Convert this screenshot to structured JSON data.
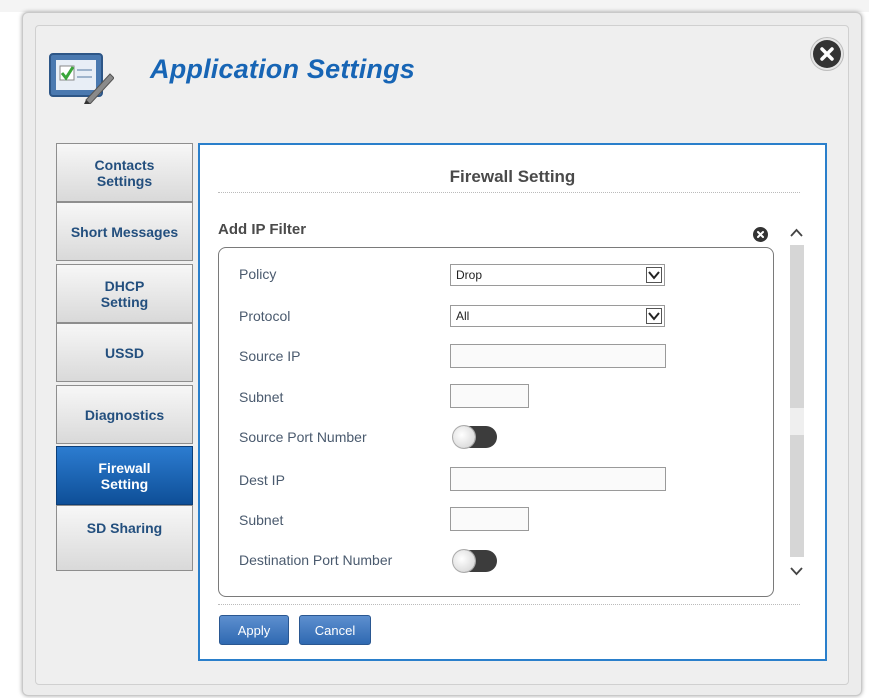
{
  "app": {
    "title": "Application Settings",
    "icon": "checklist-pen-icon"
  },
  "sidebar": {
    "items": [
      {
        "label": "Contacts Settings",
        "active": false
      },
      {
        "label": "Short Messages",
        "active": false
      },
      {
        "label": "DHCP Setting",
        "active": false
      },
      {
        "label": "USSD",
        "active": false
      },
      {
        "label": "Diagnostics",
        "active": false
      },
      {
        "label": "Firewall Setting",
        "active": true
      },
      {
        "label": "SD Sharing",
        "active": false
      }
    ]
  },
  "panel": {
    "title": "Firewall Setting",
    "section_title": "Add IP Filter"
  },
  "form": {
    "policy": {
      "label": "Policy",
      "value": "Drop"
    },
    "protocol": {
      "label": "Protocol",
      "value": "All"
    },
    "source_ip": {
      "label": "Source IP",
      "value": ""
    },
    "source_subnet": {
      "label": "Subnet",
      "value": ""
    },
    "source_port": {
      "label": "Source Port Number",
      "enabled": false
    },
    "dest_ip": {
      "label": "Dest IP",
      "value": ""
    },
    "dest_subnet": {
      "label": "Subnet",
      "value": ""
    },
    "dest_port": {
      "label": "Destination Port Number",
      "enabled": false
    }
  },
  "actions": {
    "apply": "Apply",
    "cancel": "Cancel"
  },
  "colors": {
    "accent": "#1765b5",
    "active_tab": "#1a64b4",
    "panel_border": "#2a7fcb"
  }
}
